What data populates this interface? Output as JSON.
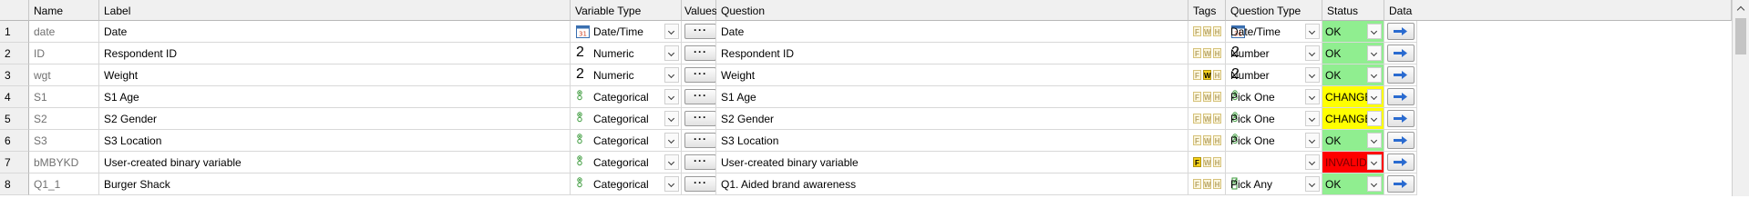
{
  "columns": {
    "name": "Name",
    "label": "Label",
    "variable_type": "Variable Type",
    "values": "Values",
    "question": "Question",
    "tags": "Tags",
    "question_type": "Question Type",
    "status": "Status",
    "data": "Data"
  },
  "tag_letters": [
    "F",
    "W",
    "H"
  ],
  "colors": {
    "status_ok": "#90ee90",
    "status_changed": "#ffff00",
    "status_invalid": "#ff0000",
    "tag_active": "#f7d21c",
    "header_bg": "#f0f0f0"
  },
  "rows": [
    {
      "num": "1",
      "name": "date",
      "label": "Date",
      "variable_type": "Date/Time",
      "vtype_icon": "calendar-icon",
      "question": "Date",
      "question_icon": "calendar-icon",
      "tags_active": [],
      "question_type": "Date/Time",
      "qtype_icon": "calendar-icon",
      "status": "OK"
    },
    {
      "num": "2",
      "name": "ID",
      "label": "Respondent ID",
      "variable_type": "Numeric",
      "vtype_icon": "numeric-icon",
      "question": "Respondent ID",
      "tags_active": [],
      "question_type": "Number",
      "qtype_icon": "numeric-icon",
      "status": "OK"
    },
    {
      "num": "3",
      "name": "wgt",
      "label": "Weight",
      "variable_type": "Numeric",
      "vtype_icon": "numeric-icon",
      "question": "Weight",
      "tags_active": [
        "W"
      ],
      "question_type": "Number",
      "qtype_icon": "numeric-icon",
      "status": "OK"
    },
    {
      "num": "4",
      "name": "S1",
      "label": "S1 Age",
      "variable_type": "Categorical",
      "vtype_icon": "categorical-icon",
      "question": "S1 Age",
      "tags_active": [],
      "question_type": "Pick One",
      "qtype_icon": "pick-one-icon",
      "status": "CHANGED"
    },
    {
      "num": "5",
      "name": "S2",
      "label": "S2 Gender",
      "variable_type": "Categorical",
      "vtype_icon": "categorical-icon",
      "question": "S2 Gender",
      "tags_active": [],
      "question_type": "Pick One",
      "qtype_icon": "pick-one-icon",
      "status": "CHANGED"
    },
    {
      "num": "6",
      "name": "S3",
      "label": "S3 Location",
      "variable_type": "Categorical",
      "vtype_icon": "categorical-icon",
      "question": "S3 Location",
      "tags_active": [],
      "question_type": "Pick One",
      "qtype_icon": "pick-one-icon",
      "status": "OK"
    },
    {
      "num": "7",
      "name": "bMBYKD",
      "label": "User-created binary variable",
      "variable_type": "Categorical",
      "vtype_icon": "categorical-icon",
      "question": "User-created binary variable",
      "tags_active": [
        "F"
      ],
      "question_type": "",
      "qtype_icon": "",
      "status": "INVALID"
    },
    {
      "num": "8",
      "name": "Q1_1",
      "label": "Burger Shack",
      "variable_type": "Categorical",
      "vtype_icon": "categorical-icon",
      "question": "Q1. Aided brand awareness",
      "tags_active": [],
      "question_type": "Pick Any",
      "qtype_icon": "pick-any-icon",
      "status": "OK"
    }
  ]
}
